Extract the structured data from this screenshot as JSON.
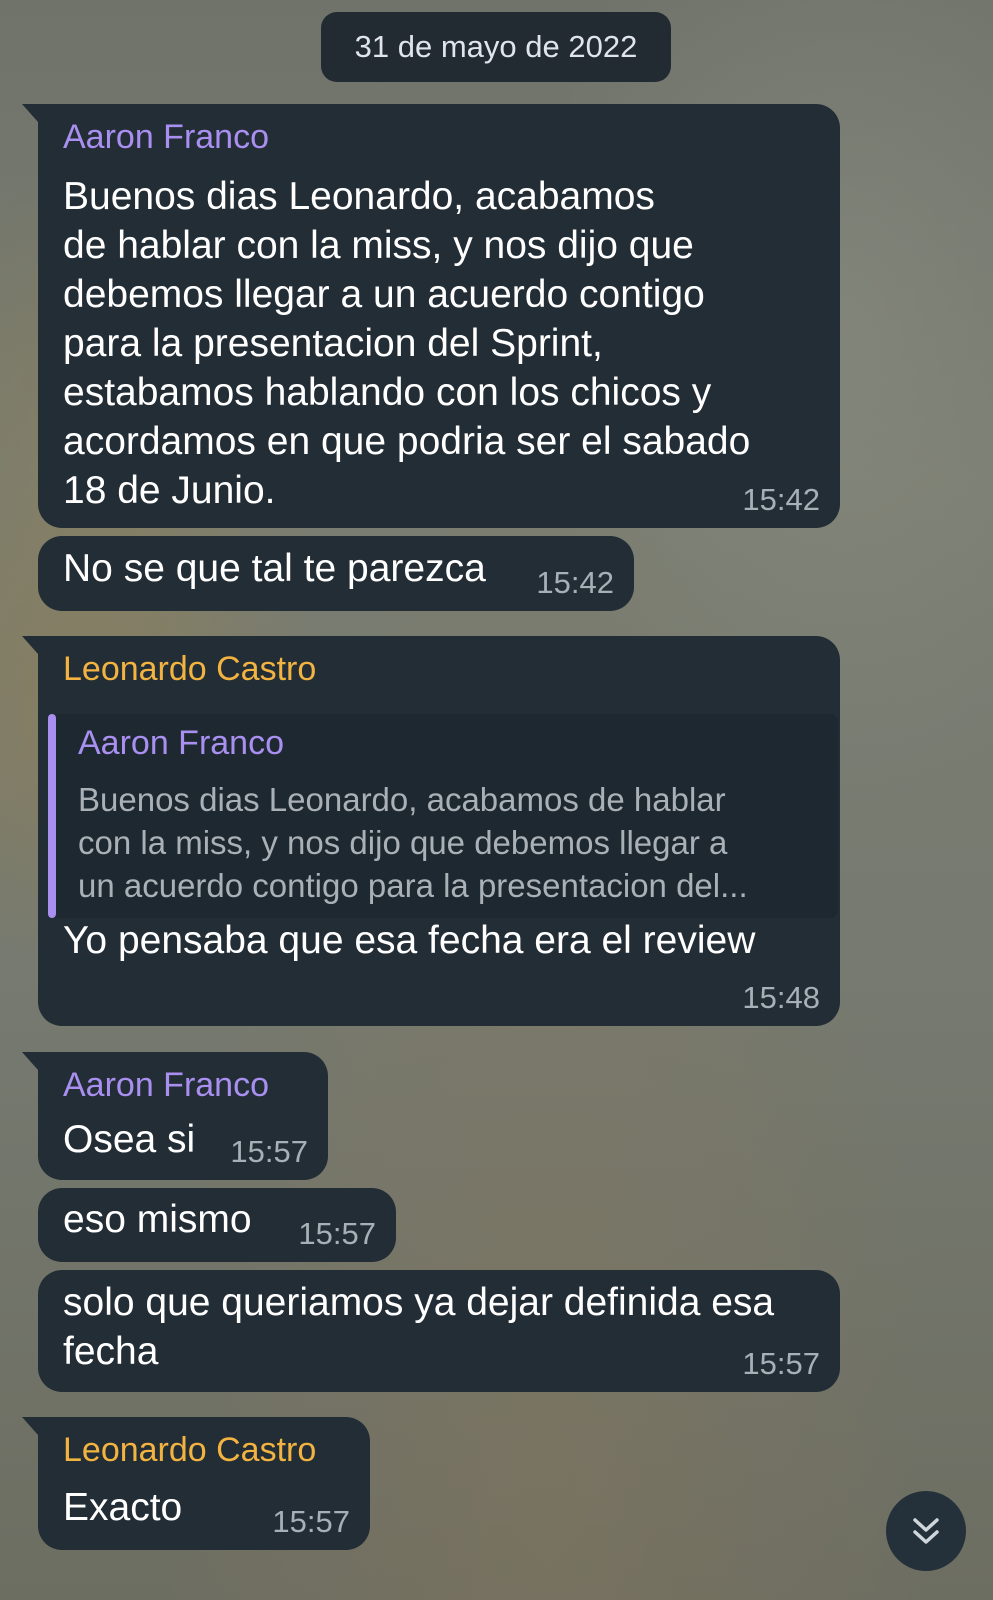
{
  "date_separator": "31 de mayo de 2022",
  "messages": [
    {
      "sender": "Aaron Franco",
      "text": "Buenos dias Leonardo, acabamos\nde hablar con la miss, y nos dijo que\ndebemos llegar a un acuerdo contigo\npara la presentacion del Sprint,\nestabamos hablando con los chicos y\nacordamos en que podria ser el sabado\n18 de Junio.",
      "time": "15:42"
    },
    {
      "text": "No se que tal te parezca",
      "time": "15:42"
    },
    {
      "sender": "Leonardo Castro",
      "reply": {
        "sender": "Aaron Franco",
        "text": "Buenos dias Leonardo, acabamos de hablar\ncon la miss, y nos dijo que debemos llegar a\nun acuerdo contigo para la presentacion del..."
      },
      "text": "Yo pensaba que esa fecha era el review",
      "time": "15:48"
    },
    {
      "sender": "Aaron Franco",
      "text": "Osea si",
      "time": "15:57"
    },
    {
      "text": "eso mismo",
      "time": "15:57"
    },
    {
      "text": "solo que queriamos ya dejar definida esa\nfecha",
      "time": "15:57"
    },
    {
      "sender": "Leonardo Castro",
      "text": "Exacto",
      "time": "15:57"
    }
  ],
  "colors": {
    "bubble": "#232d35",
    "sender_aaron": "#a88ff0",
    "sender_leonardo": "#f3b341",
    "time": "#a7b0b6"
  },
  "icons": {
    "scroll_down": "double-chevron-down-icon"
  }
}
